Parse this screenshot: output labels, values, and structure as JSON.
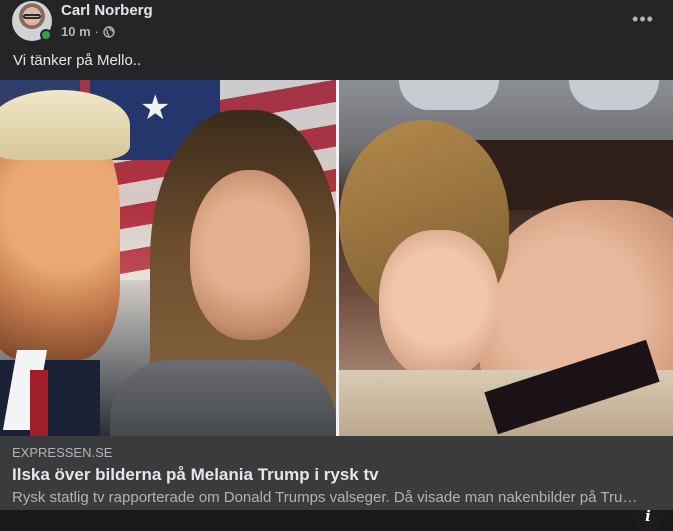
{
  "post": {
    "author": "Carl Norberg",
    "time": "10 m",
    "separator": "·",
    "privacy_icon": "globe-icon",
    "more_label": "•••",
    "text": "Vi tänker på Mello.."
  },
  "media": {
    "info_label": "i"
  },
  "link_preview": {
    "domain": "EXPRESSEN.SE",
    "title": "Ilska över bilderna på Melania Trump i rysk tv",
    "description": "Rysk statlig tv rapporterade om Donald Trumps valseger. Då visade man nakenbilder på Trump..."
  },
  "colors": {
    "background": "#242526",
    "link_box": "#3a3b3c",
    "primary_text": "#e4e6eb",
    "secondary_text": "#b0b3b8",
    "online": "#31a24c"
  }
}
